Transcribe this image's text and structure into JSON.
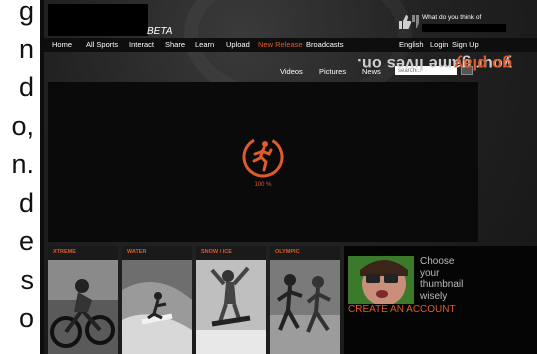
{
  "page_strip": {
    "fragments": [
      "g",
      "n",
      "d",
      "o,",
      "n.",
      "d",
      "e",
      "s",
      "o"
    ]
  },
  "header": {
    "beta_label": "BETA",
    "feedback_label": "What do you think of"
  },
  "nav": {
    "items": [
      "Home",
      "All Sports",
      "Interact",
      "Share",
      "Learn",
      "Upload",
      "New Release",
      "Broadcasts"
    ],
    "right": [
      "English",
      "Login",
      "Sign Up"
    ]
  },
  "subnav": {
    "items": [
      "Videos",
      "Pictures",
      "News"
    ],
    "search_placeholder": "search..."
  },
  "player": {
    "progress_text": "100 %",
    "progress_value": 1.0
  },
  "tagline": {
    "main": "your game lives on.",
    "accent": "go play"
  },
  "categories": [
    "XTREME",
    "WATER",
    "SNOW / ICE",
    "OLYMPIC"
  ],
  "account": {
    "choose_lines": [
      "Choose",
      "your",
      "thumbnail",
      "wisely"
    ],
    "create_label": "CREATE AN ACCOUNT"
  },
  "colors": {
    "accent": "#e05a2a",
    "background": "#1c1c1c",
    "nav_background": "#0e0e0e"
  }
}
